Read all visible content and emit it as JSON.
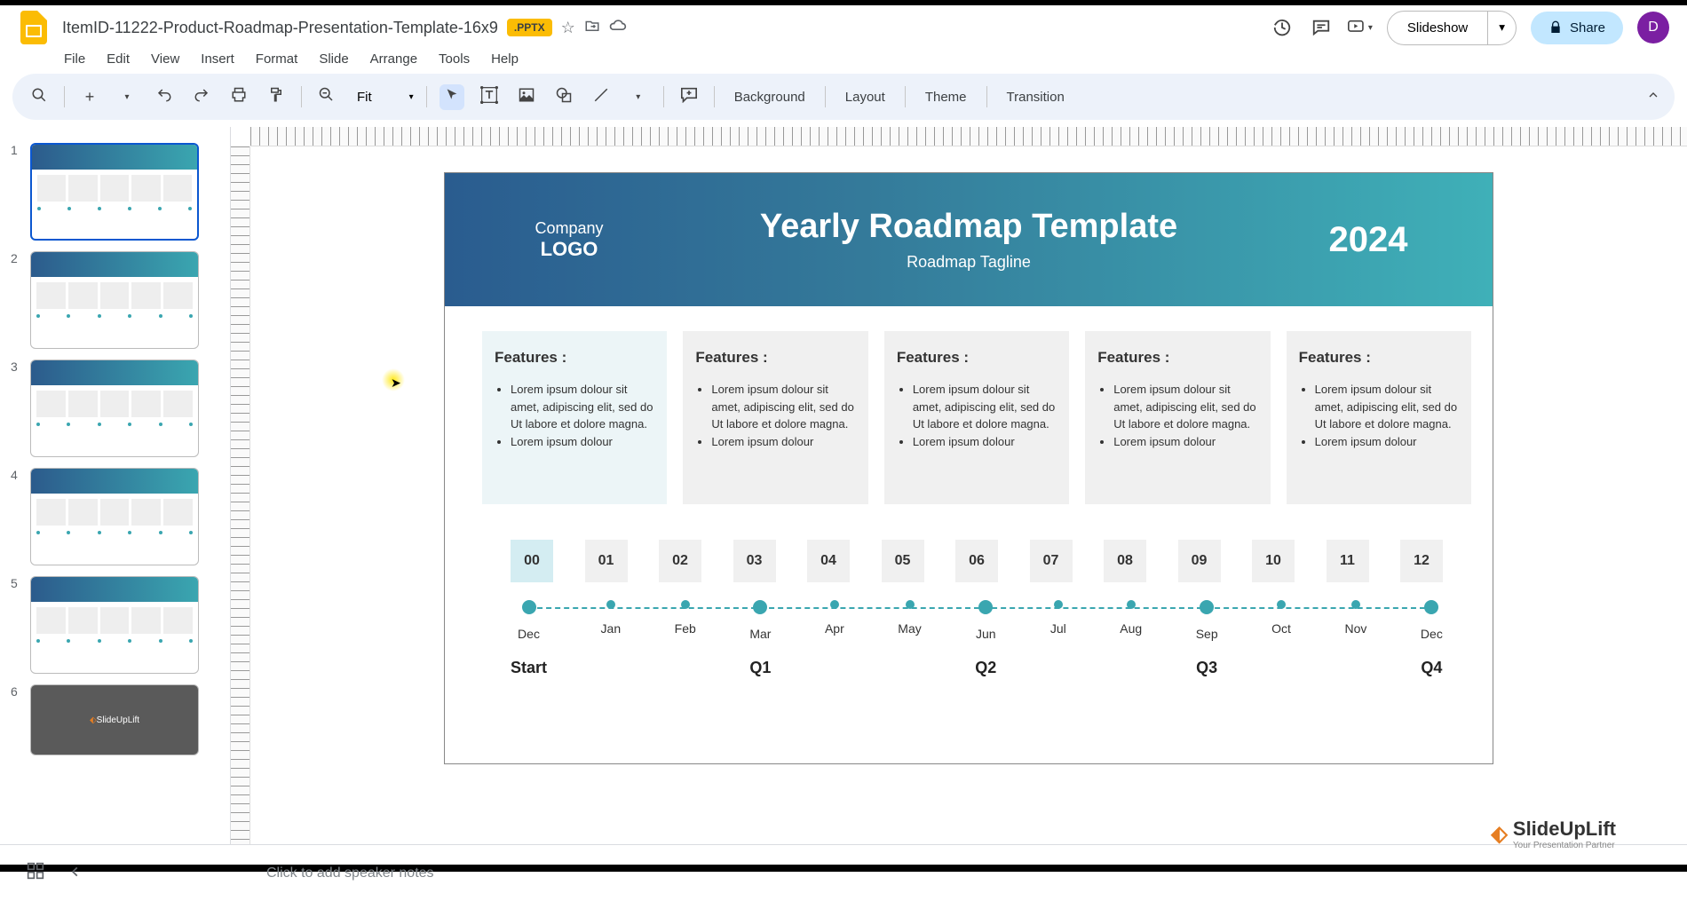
{
  "header": {
    "doc_title": "ItemID-11222-Product-Roadmap-Presentation-Template-16x9",
    "badge": ".PPTX",
    "slideshow_label": "Slideshow",
    "share_label": "Share",
    "avatar_letter": "D"
  },
  "menu": {
    "file": "File",
    "edit": "Edit",
    "view": "View",
    "insert": "Insert",
    "format": "Format",
    "slide": "Slide",
    "arrange": "Arrange",
    "tools": "Tools",
    "help": "Help"
  },
  "toolbar": {
    "zoom": "Fit",
    "background": "Background",
    "layout": "Layout",
    "theme": "Theme",
    "transition": "Transition"
  },
  "thumbnails": [
    {
      "num": "1",
      "active": true
    },
    {
      "num": "2",
      "active": false
    },
    {
      "num": "3",
      "active": false
    },
    {
      "num": "4",
      "active": false
    },
    {
      "num": "5",
      "active": false
    },
    {
      "num": "6",
      "active": false
    }
  ],
  "slide": {
    "logo_line1": "Company",
    "logo_line2": "LOGO",
    "title": "Yearly Roadmap Template",
    "tagline": "Roadmap Tagline",
    "year": "2024",
    "feature_heading": "Features :",
    "feature_items": [
      "Lorem ipsum dolour sit amet, adipiscing elit, sed do Ut labore et dolore magna.",
      "Lorem ipsum dolour"
    ],
    "numbers": [
      "00",
      "01",
      "02",
      "03",
      "04",
      "05",
      "06",
      "07",
      "08",
      "09",
      "10",
      "11",
      "12"
    ],
    "months": [
      "Dec",
      "Jan",
      "Feb",
      "Mar",
      "Apr",
      "May",
      "Jun",
      "Jul",
      "Aug",
      "Sep",
      "Oct",
      "Nov",
      "Dec"
    ],
    "quarters": {
      "0": "Start",
      "3": "Q1",
      "6": "Q2",
      "9": "Q3",
      "12": "Q4"
    }
  },
  "notes": {
    "placeholder": "Click to add speaker notes"
  },
  "watermark": {
    "brand": "SlideUpLift",
    "sub": "Your Presentation Partner"
  }
}
